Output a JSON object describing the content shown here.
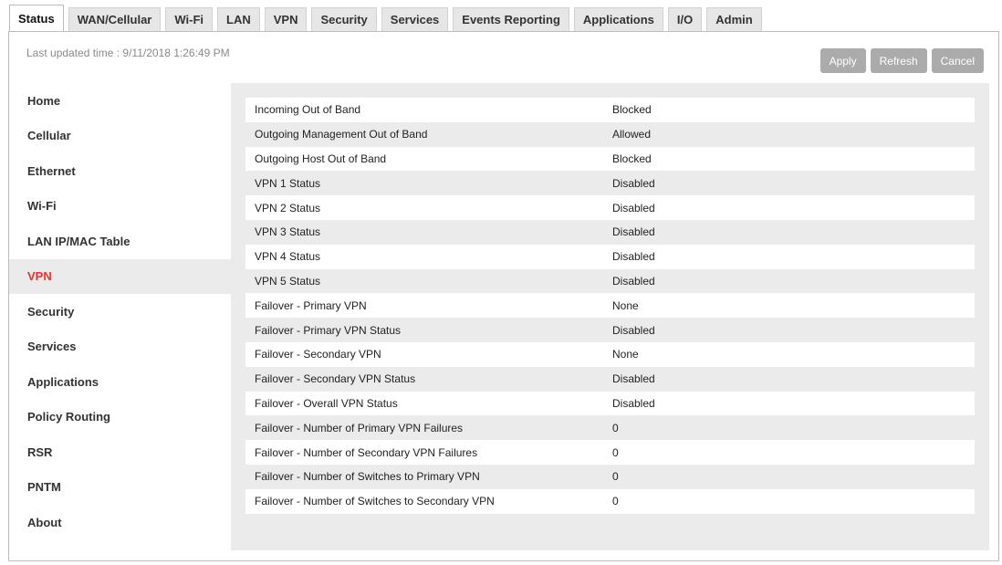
{
  "tabs": [
    "Status",
    "WAN/Cellular",
    "Wi-Fi",
    "LAN",
    "VPN",
    "Security",
    "Services",
    "Events Reporting",
    "Applications",
    "I/O",
    "Admin"
  ],
  "active_tab": "Status",
  "header": {
    "last_updated": "Last updated time : 9/11/2018 1:26:49 PM"
  },
  "buttons": {
    "apply": "Apply",
    "refresh": "Refresh",
    "cancel": "Cancel"
  },
  "sidebar": {
    "items": [
      "Home",
      "Cellular",
      "Ethernet",
      "Wi-Fi",
      "LAN IP/MAC Table",
      "VPN",
      "Security",
      "Services",
      "Applications",
      "Policy Routing",
      "RSR",
      "PNTM",
      "About"
    ],
    "active": "VPN",
    "active_color": "#e8322c"
  },
  "status_table": [
    [
      "Incoming Out of Band",
      "Blocked"
    ],
    [
      "Outgoing Management Out of Band",
      "Allowed"
    ],
    [
      "Outgoing Host Out of Band",
      "Blocked"
    ],
    [
      "VPN 1 Status",
      "Disabled"
    ],
    [
      "VPN 2 Status",
      "Disabled"
    ],
    [
      "VPN 3 Status",
      "Disabled"
    ],
    [
      "VPN 4 Status",
      "Disabled"
    ],
    [
      "VPN 5 Status",
      "Disabled"
    ],
    [
      "Failover - Primary VPN",
      "None"
    ],
    [
      "Failover - Primary VPN Status",
      "Disabled"
    ],
    [
      "Failover - Secondary VPN",
      "None"
    ],
    [
      "Failover - Secondary VPN Status",
      "Disabled"
    ],
    [
      "Failover - Overall VPN Status",
      "Disabled"
    ],
    [
      "Failover - Number of Primary VPN Failures",
      "0"
    ],
    [
      "Failover - Number of Secondary VPN Failures",
      "0"
    ],
    [
      "Failover - Number of Switches to Primary VPN",
      "0"
    ],
    [
      "Failover - Number of Switches to Secondary VPN",
      "0"
    ]
  ]
}
